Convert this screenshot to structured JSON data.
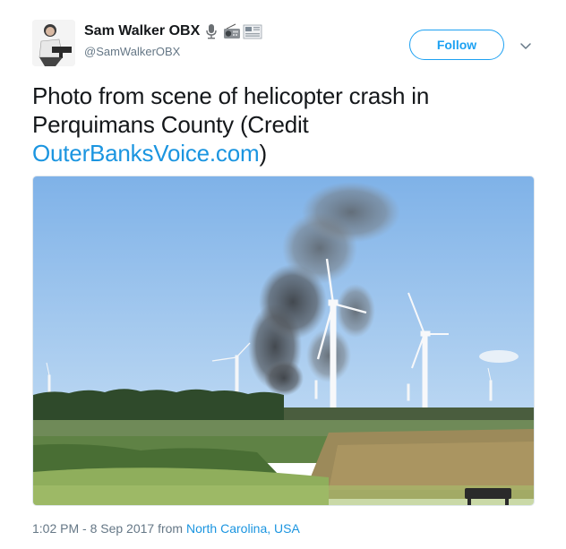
{
  "user": {
    "display_name": "Sam Walker OBX",
    "handle": "@SamWalkerOBX",
    "name_emojis": [
      "microphone-icon",
      "radio-icon",
      "newspaper-icon"
    ]
  },
  "actions": {
    "follow_label": "Follow"
  },
  "tweet": {
    "text_before_link": "Photo from scene of helicopter crash in Perquimans County (Credit ",
    "link_text": "OuterBanksVoice.com",
    "text_after_link": ")"
  },
  "footer": {
    "timestamp": "1:02 PM - 8 Sep 2017",
    "from_word": " from ",
    "place": "North Carolina, USA"
  },
  "colors": {
    "accent": "#1da1f2",
    "link": "#1b95e0",
    "muted": "#657786"
  }
}
